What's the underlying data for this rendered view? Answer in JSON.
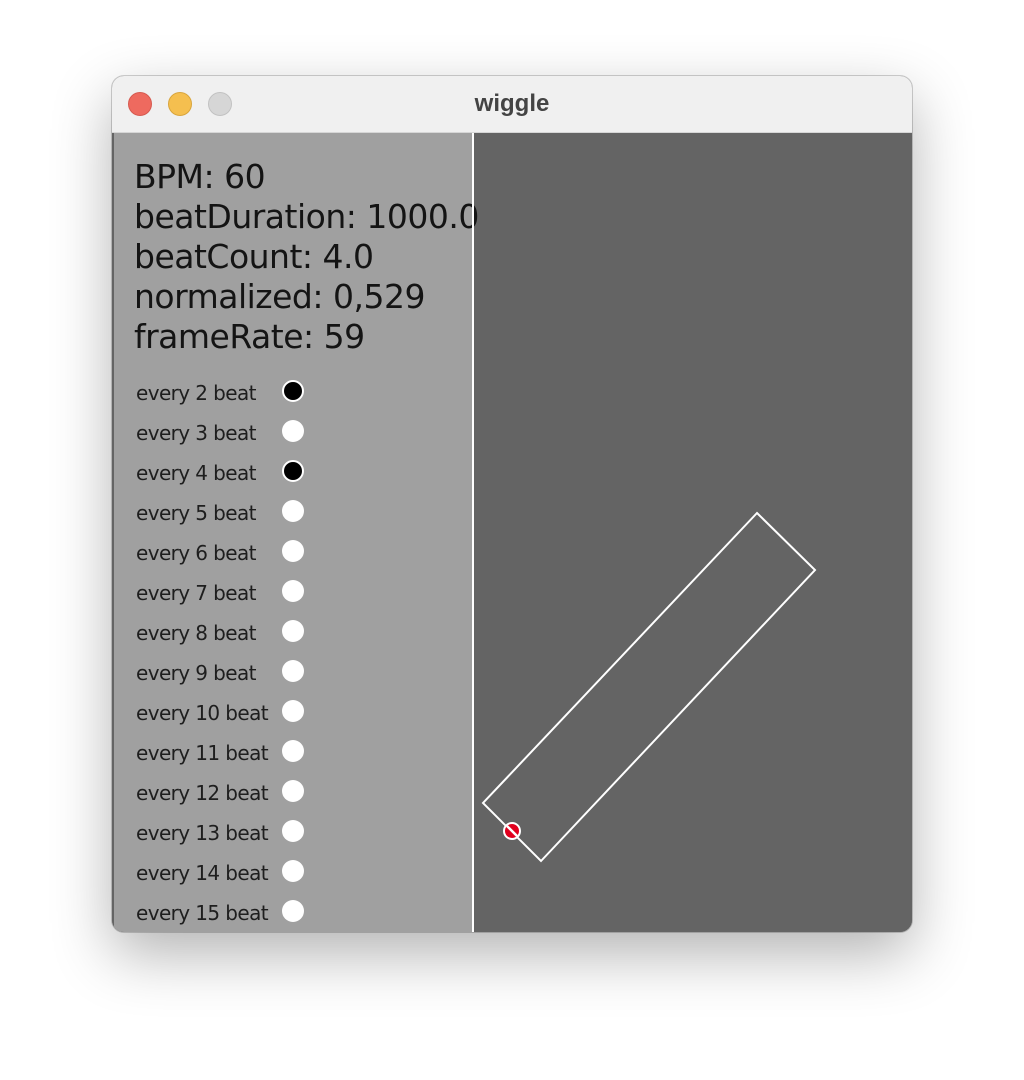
{
  "window": {
    "title": "wiggle",
    "traffic_lights": [
      "close",
      "minimize",
      "zoom"
    ]
  },
  "stats": [
    "BPM: 60",
    "beatDuration: 1000.0",
    "beatCount: 4.0",
    "normalized: 0,529",
    "frameRate: 59"
  ],
  "beats": [
    {
      "label": "every 2 beat",
      "active": true
    },
    {
      "label": "every 3 beat",
      "active": false
    },
    {
      "label": "every 4 beat",
      "active": true
    },
    {
      "label": "every 5 beat",
      "active": false
    },
    {
      "label": "every 6 beat",
      "active": false
    },
    {
      "label": "every 7 beat",
      "active": false
    },
    {
      "label": "every 8 beat",
      "active": false
    },
    {
      "label": "every 9 beat",
      "active": false
    },
    {
      "label": "every 10 beat",
      "active": false
    },
    {
      "label": "every 11 beat",
      "active": false
    },
    {
      "label": "every 12 beat",
      "active": false
    },
    {
      "label": "every 13 beat",
      "active": false
    },
    {
      "label": "every 14 beat",
      "active": false
    },
    {
      "label": "every 15 beat",
      "active": false
    }
  ],
  "colors": {
    "panel": "#a0a0a0",
    "canvas": "#646464",
    "outline": "#ffffff",
    "marker": "#e0001e"
  }
}
